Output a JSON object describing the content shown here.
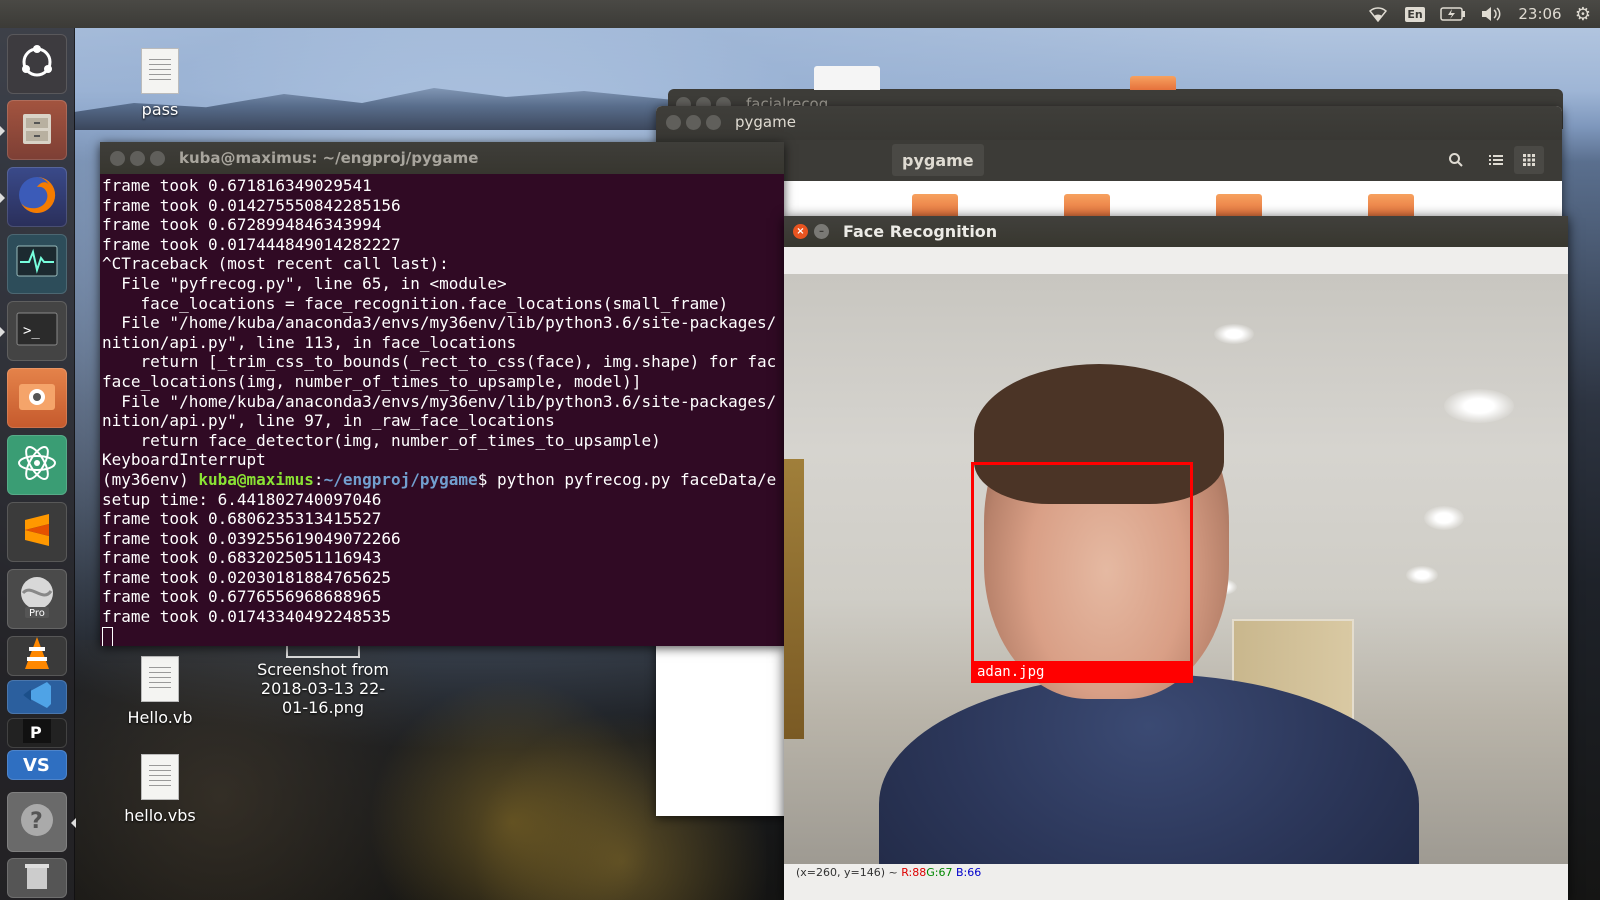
{
  "top_panel": {
    "language": "En",
    "clock": "23:06"
  },
  "launcher": {
    "items": [
      {
        "name": "dash",
        "color": "#3d3b3f"
      },
      {
        "name": "files",
        "color": "#8b4a3f"
      },
      {
        "name": "firefox",
        "color": "#e66000"
      },
      {
        "name": "system-monitor",
        "color": "#2d4d5a"
      },
      {
        "name": "terminal",
        "color": "#2c2c2c"
      },
      {
        "name": "screenshot",
        "color": "#d96d3b"
      },
      {
        "name": "atom",
        "color": "#3a9d74"
      },
      {
        "name": "sublime",
        "color": "#3b3b3b"
      },
      {
        "name": "google-earth-pro",
        "color": "#4a4a4a",
        "badge": "Pro"
      },
      {
        "name": "vlc",
        "color": "#3a3a3a"
      },
      {
        "name": "visual-studio-code",
        "color": "#2b5f9e"
      },
      {
        "name": "help",
        "color": "#6a6a6a"
      },
      {
        "name": "trash",
        "color": "#555555"
      }
    ]
  },
  "desktop": {
    "icons": [
      {
        "label": "pass"
      },
      {
        "label": "Hello.vb"
      },
      {
        "label": "Screenshot from 2018-03-13 22-01-16.png"
      },
      {
        "label": "hello.vbs"
      }
    ]
  },
  "windows": {
    "facialrecog": {
      "title": "facialrecog"
    },
    "pygame": {
      "title": "pygame",
      "path_button": "pygame"
    },
    "terminal": {
      "title": "kuba@maximus: ~/engproj/pygame",
      "lines_before": [
        "frame took 0.671816349029541",
        "frame took 0.014275550842285156",
        "frame took 0.6728994846343994",
        "frame took 0.017444849014282227",
        "^CTraceback (most recent call last):",
        "  File \"pyfrecog.py\", line 65, in <module>",
        "    face_locations = face_recognition.face_locations(small_frame)",
        "  File \"/home/kuba/anaconda3/envs/my36env/lib/python3.6/site-packages/",
        "nition/api.py\", line 113, in face_locations",
        "    return [_trim_css_to_bounds(_rect_to_css(face), img.shape) for fac",
        "face_locations(img, number_of_times_to_upsample, model)]",
        "  File \"/home/kuba/anaconda3/envs/my36env/lib/python3.6/site-packages/",
        "nition/api.py\", line 97, in _raw_face_locations",
        "    return face_detector(img, number_of_times_to_upsample)",
        "KeyboardInterrupt"
      ],
      "prompt_env": "(my36env) ",
      "prompt_user": "kuba@maximus",
      "prompt_sep": ":",
      "prompt_path": "~/engproj/pygame",
      "prompt_cmd": "$ python pyfrecog.py faceData/e",
      "lines_after": [
        "setup time: 6.441802740097046",
        "frame took 0.6806235313415527",
        "frame took 0.039255619049072266",
        "frame took 0.6832025051116943",
        "frame took 0.02030181884765625",
        "frame took 0.6776556968688965",
        "frame took 0.01743340492248535"
      ]
    },
    "face_recognition": {
      "title": "Face Recognition",
      "face_label": "adan.jpg",
      "status": {
        "coords": "(x=260, y=146) ~ ",
        "r": "R:88",
        "g": "G:67",
        "b": "B:66"
      }
    }
  }
}
